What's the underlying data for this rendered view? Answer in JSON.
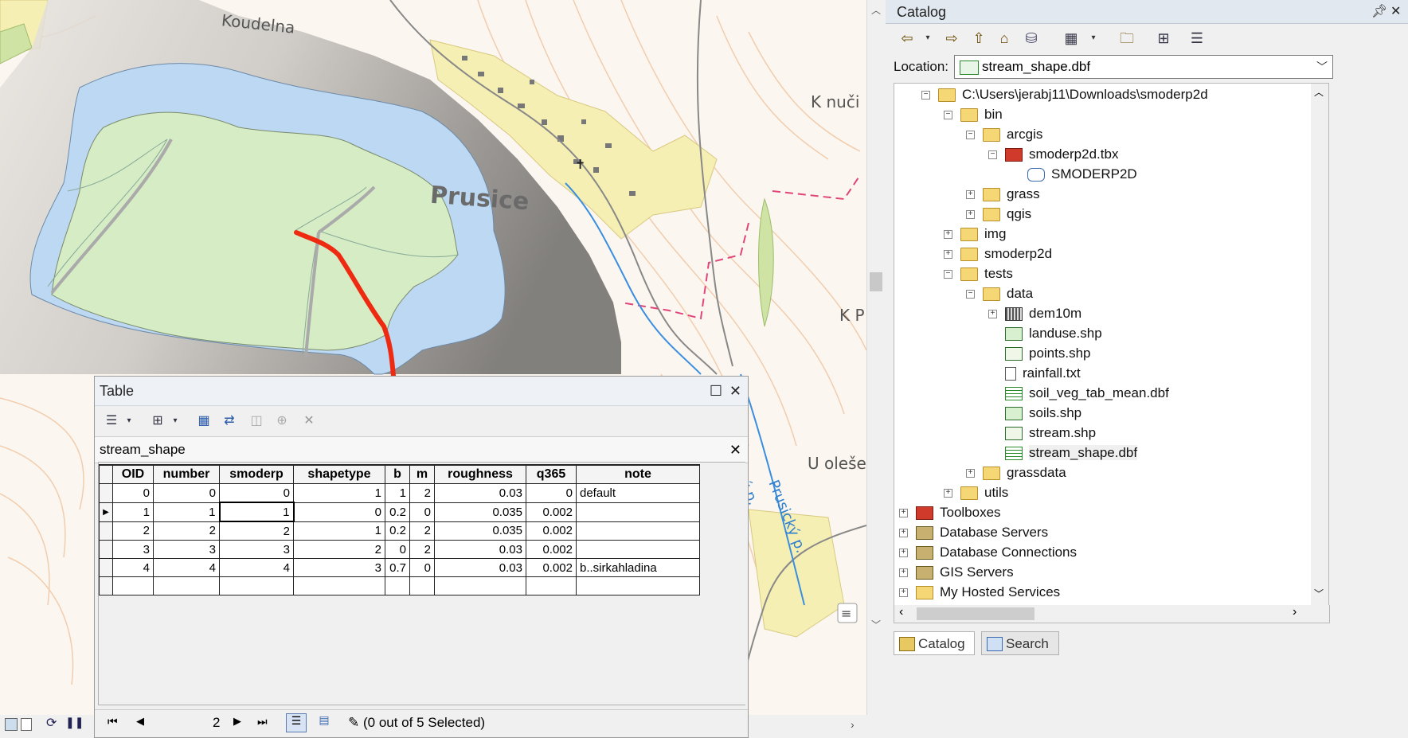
{
  "map": {
    "labels": [
      "Koudelna",
      "K nuči",
      "Prusice",
      "K P",
      "U oleše",
      "Prusický p.",
      "Prusický p."
    ]
  },
  "table_window": {
    "title": "Table",
    "tab_name": "stream_shape",
    "columns": [
      "OID",
      "number",
      "smoderp",
      "shapetype",
      "b",
      "m",
      "roughness",
      "q365",
      "note"
    ],
    "rows": [
      {
        "OID": "0",
        "number": "0",
        "smoderp": "0",
        "shapetype": "1",
        "b": "1",
        "m": "2",
        "roughness": "0.03",
        "q365": "0",
        "note": "default"
      },
      {
        "OID": "1",
        "number": "1",
        "smoderp": "1",
        "shapetype": "0",
        "b": "0.2",
        "m": "0",
        "roughness": "0.035",
        "q365": "0.002",
        "note": ""
      },
      {
        "OID": "2",
        "number": "2",
        "smoderp": "2",
        "shapetype": "1",
        "b": "0.2",
        "m": "2",
        "roughness": "0.035",
        "q365": "0.002",
        "note": ""
      },
      {
        "OID": "3",
        "number": "3",
        "smoderp": "3",
        "shapetype": "2",
        "b": "0",
        "m": "2",
        "roughness": "0.03",
        "q365": "0.002",
        "note": ""
      },
      {
        "OID": "4",
        "number": "4",
        "smoderp": "4",
        "shapetype": "3",
        "b": "0.7",
        "m": "0",
        "roughness": "0.03",
        "q365": "0.002",
        "note": "b..sirkahladina"
      }
    ],
    "current_record": "2",
    "selection_status": "(0 out of 5 Selected)"
  },
  "catalog": {
    "title": "Catalog",
    "location_label": "Location:",
    "location_value": "stream_shape.dbf",
    "tree": [
      {
        "label": "C:\\Users\\jerabj11\\Downloads\\smoderp2d",
        "depth": 0,
        "pm": "−",
        "icon": "folder-link-icon"
      },
      {
        "label": "bin",
        "depth": 1,
        "pm": "−",
        "icon": "folder-icon"
      },
      {
        "label": "arcgis",
        "depth": 2,
        "pm": "−",
        "icon": "folder-icon"
      },
      {
        "label": "smoderp2d.tbx",
        "depth": 3,
        "pm": "−",
        "icon": "toolbox-icon"
      },
      {
        "label": "SMODERP2D",
        "depth": 4,
        "pm": "",
        "icon": "script-icon"
      },
      {
        "label": "grass",
        "depth": 2,
        "pm": "+",
        "icon": "folder-icon"
      },
      {
        "label": "qgis",
        "depth": 2,
        "pm": "+",
        "icon": "folder-icon"
      },
      {
        "label": "img",
        "depth": 1,
        "pm": "+",
        "icon": "folder-icon"
      },
      {
        "label": "smoderp2d",
        "depth": 1,
        "pm": "+",
        "icon": "folder-icon"
      },
      {
        "label": "tests",
        "depth": 1,
        "pm": "−",
        "icon": "folder-icon"
      },
      {
        "label": "data",
        "depth": 2,
        "pm": "−",
        "icon": "folder-icon"
      },
      {
        "label": "dem10m",
        "depth": 3,
        "pm": "+",
        "icon": "raster-icon"
      },
      {
        "label": "landuse.shp",
        "depth": 3,
        "pm": "",
        "icon": "polygon-shapefile-icon"
      },
      {
        "label": "points.shp",
        "depth": 3,
        "pm": "",
        "icon": "point-shapefile-icon"
      },
      {
        "label": "rainfall.txt",
        "depth": 3,
        "pm": "",
        "icon": "text-file-icon"
      },
      {
        "label": "soil_veg_tab_mean.dbf",
        "depth": 3,
        "pm": "",
        "icon": "dbf-table-icon"
      },
      {
        "label": "soils.shp",
        "depth": 3,
        "pm": "",
        "icon": "polygon-shapefile-icon"
      },
      {
        "label": "stream.shp",
        "depth": 3,
        "pm": "",
        "icon": "line-shapefile-icon"
      },
      {
        "label": "stream_shape.dbf",
        "depth": 3,
        "pm": "",
        "icon": "dbf-table-icon",
        "selected": true
      },
      {
        "label": "grassdata",
        "depth": 2,
        "pm": "+",
        "icon": "folder-icon"
      },
      {
        "label": "utils",
        "depth": 1,
        "pm": "+",
        "icon": "folder-icon"
      },
      {
        "label": "Toolboxes",
        "depth": -1,
        "pm": "+",
        "icon": "toolboxes-icon"
      },
      {
        "label": "Database Servers",
        "depth": -1,
        "pm": "+",
        "icon": "database-servers-icon"
      },
      {
        "label": "Database Connections",
        "depth": -1,
        "pm": "+",
        "icon": "database-connections-icon"
      },
      {
        "label": "GIS Servers",
        "depth": -1,
        "pm": "+",
        "icon": "gis-servers-icon"
      },
      {
        "label": "My Hosted Services",
        "depth": -1,
        "pm": "+",
        "icon": "hosted-services-icon"
      }
    ],
    "tabs": [
      {
        "label": "Catalog",
        "active": true
      },
      {
        "label": "Search",
        "active": false
      }
    ]
  },
  "colors": {
    "catchment_fill": "#d6ecc4",
    "buffer_fill": "#bcd8f2",
    "stream_red": "#ee2a10",
    "map_background": "#fbf6ef"
  }
}
